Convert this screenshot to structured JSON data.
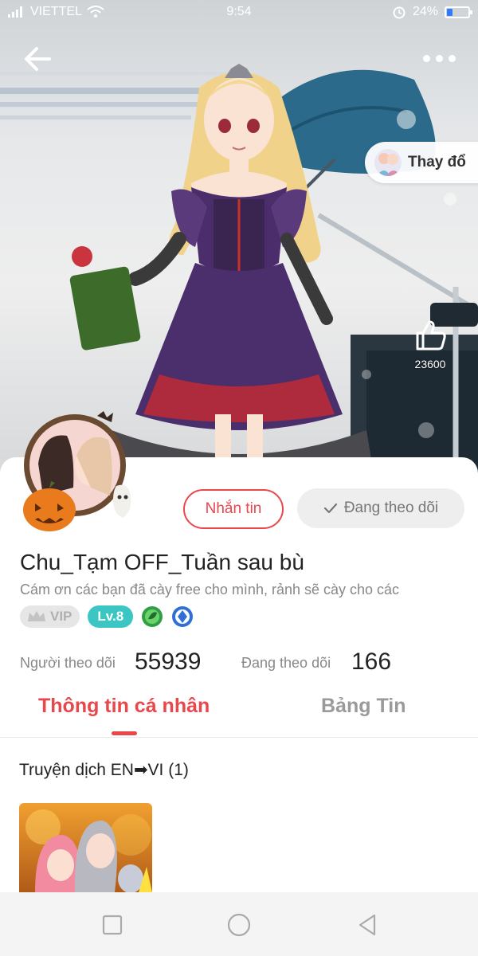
{
  "status_bar": {
    "carrier": "VIETTEL",
    "time": "9:54",
    "battery": "24%",
    "battery_level": 0.24,
    "icons": [
      "signal-icon",
      "wifi-icon",
      "alarm-icon",
      "battery-icon"
    ]
  },
  "header": {
    "back_icon": "arrow-left-icon",
    "more_icon": "more-horizontal-icon",
    "change_outfit_label": "Thay đổ",
    "like_count": "23600"
  },
  "profile": {
    "message_button": "Nhắn tin",
    "following_button": "Đang theo dõi",
    "username": "Chu_Tạm OFF_Tuần sau bù",
    "bio": "Cám ơn các bạn đã cày free cho mình, rảnh sẽ cày cho các",
    "badges": {
      "vip": "VIP",
      "level": "Lv.8"
    },
    "stats": {
      "followers_label": "Người theo dõi",
      "followers_value": "55939",
      "following_label": "Đang theo dõi",
      "following_value": "166"
    }
  },
  "tabs": [
    {
      "label": "Thông tin cá nhân",
      "active": true
    },
    {
      "label": "Bảng Tin",
      "active": false
    }
  ],
  "content": {
    "section_title": "Truyện dịch EN➡VI (1)"
  },
  "navbar": {
    "icons": [
      "recent-apps-icon",
      "home-icon",
      "back-triangle-icon"
    ]
  },
  "colors": {
    "accent": "#e8474c",
    "level_badge": "#3cc6c3",
    "battery": "#2f7bff"
  }
}
